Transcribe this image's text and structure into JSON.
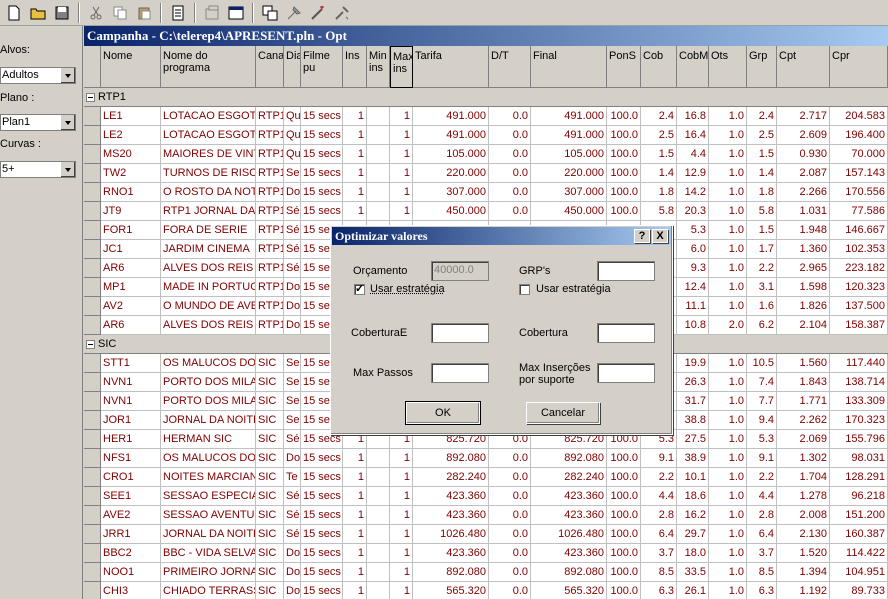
{
  "toolbar": {
    "icons": [
      "new-file-icon",
      "open-folder-icon",
      "save-icon",
      "cut-icon",
      "copy-icon",
      "paste-icon",
      "report-icon",
      "properties-icon",
      "window-icon",
      "grid-icon",
      "tools-icon",
      "wand-icon",
      "optimize-icon"
    ]
  },
  "left_panel": {
    "alvos_label": "Alvos:",
    "alvos_value": "Adultos",
    "plano_label": "Plano :",
    "plano_value": "Plan1",
    "curvas_label": "Curvas :",
    "curvas_value": "5+"
  },
  "window": {
    "title": "Campanha - C:\\telerep4\\APRESENT.pln - Opt"
  },
  "grid": {
    "columns": [
      "Nome",
      "Nome do programa",
      "Canal",
      "Dia",
      "Filme pu",
      "Ins",
      "Min ins",
      "Max ins",
      "Tarifa",
      "D/T",
      "Final",
      "PonS",
      "Cob",
      "CobM",
      "Ots",
      "Grp",
      "Cpt",
      "Cpr"
    ],
    "groups": [
      {
        "name": "RTP1",
        "rows": [
          [
            "LE1",
            "LOTACAO ESGOT",
            "RTP1",
            "Qu",
            "15 secs",
            "1",
            "",
            "1",
            "491.000",
            "0.0",
            "491.000",
            "100.0",
            "2.4",
            "16.8",
            "1.0",
            "2.4",
            "2.717",
            "204.583"
          ],
          [
            "LE2",
            "LOTACAO ESGOT",
            "RTP1",
            "Qu",
            "15 secs",
            "1",
            "",
            "1",
            "491.000",
            "0.0",
            "491.000",
            "100.0",
            "2.5",
            "16.4",
            "1.0",
            "2.5",
            "2.609",
            "196.400"
          ],
          [
            "MS20",
            "MAIORES DE VINTI",
            "RTP1",
            "Qu",
            "15 secs",
            "1",
            "",
            "1",
            "105.000",
            "0.0",
            "105.000",
            "100.0",
            "1.5",
            "4.4",
            "1.0",
            "1.5",
            "0.930",
            "70.000"
          ],
          [
            "TW2",
            "TURNOS DE RISCO",
            "RTP1",
            "Se",
            "15 secs",
            "1",
            "",
            "1",
            "220.000",
            "0.0",
            "220.000",
            "100.0",
            "1.4",
            "12.9",
            "1.0",
            "1.4",
            "2.087",
            "157.143"
          ],
          [
            "RNO1",
            "O ROSTO DA NOT",
            "RTP1",
            "Do",
            "15 secs",
            "1",
            "",
            "1",
            "307.000",
            "0.0",
            "307.000",
            "100.0",
            "1.8",
            "14.2",
            "1.0",
            "1.8",
            "2.266",
            "170.556"
          ],
          [
            "JT9",
            "RTP1 JORNAL DA",
            "RTP1",
            "Sé",
            "15 secs",
            "1",
            "",
            "1",
            "450.000",
            "0.0",
            "450.000",
            "100.0",
            "5.8",
            "20.3",
            "1.0",
            "5.8",
            "1.031",
            "77.586"
          ],
          [
            "FOR1",
            "FORA DE SERIE",
            "RTP1",
            "Sé",
            "15 se",
            "",
            "",
            "",
            "",
            "",
            "",
            "",
            "",
            "5.3",
            "1.0",
            "1.5",
            "1.948",
            "146.667"
          ],
          [
            "JC1",
            "JARDIM CINEMA",
            "RTP1",
            "Sé",
            "15 se",
            "",
            "",
            "",
            "",
            "",
            "",
            "",
            "",
            "6.0",
            "1.0",
            "1.7",
            "1.360",
            "102.353"
          ],
          [
            "AR6",
            "ALVES DOS REIS",
            "RTP1",
            "Sé",
            "15 se",
            "",
            "",
            "",
            "",
            "",
            "",
            "",
            "",
            "9.3",
            "1.0",
            "2.2",
            "2.965",
            "223.182"
          ],
          [
            "MP1",
            "MADE IN PORTUGA",
            "RTP1",
            "Do",
            "15 se",
            "",
            "",
            "",
            "",
            "",
            "",
            "",
            "",
            "12.4",
            "1.0",
            "3.1",
            "1.598",
            "120.323"
          ],
          [
            "AV2",
            "O MUNDO DE AVE",
            "RTP1",
            "Do",
            "15 se",
            "",
            "",
            "",
            "",
            "",
            "",
            "",
            "",
            "11.1",
            "1.0",
            "1.6",
            "1.826",
            "137.500"
          ],
          [
            "AR6",
            "ALVES DOS REIS",
            "RTP1",
            "Do",
            "15 se",
            "",
            "",
            "",
            "",
            "",
            "",
            "",
            "",
            "10.8",
            "2.0",
            "6.2",
            "2.104",
            "158.387"
          ]
        ]
      },
      {
        "name": "SIC",
        "rows": [
          [
            "STT1",
            "OS MALUCOS DO",
            "SIC",
            "Se",
            "15 se",
            "",
            "",
            "",
            "",
            "",
            "",
            "",
            "",
            "19.9",
            "1.0",
            "10.5",
            "1.560",
            "117.440"
          ],
          [
            "NVN1",
            "PORTO DOS MILA(",
            "SIC",
            "Se",
            "15 se",
            "",
            "",
            "",
            "",
            "",
            "",
            "",
            "",
            "26.3",
            "1.0",
            "7.4",
            "1.843",
            "138.714"
          ],
          [
            "NVN1",
            "PORTO DOS MILA(",
            "SIC",
            "Se",
            "15 se",
            "",
            "",
            "",
            "",
            "",
            "",
            "",
            "",
            "31.7",
            "1.0",
            "7.7",
            "1.771",
            "133.309"
          ],
          [
            "JOR1",
            "JORNAL DA NOITE",
            "SIC",
            "Se",
            "15 se",
            "",
            "",
            "",
            "",
            "",
            "",
            "",
            "",
            "38.8",
            "1.0",
            "9.4",
            "2.262",
            "170.323"
          ],
          [
            "HER1",
            "HERMAN SIC",
            "SIC",
            "Sé",
            "15 secs",
            "1",
            "",
            "1",
            "825.720",
            "0.0",
            "825.720",
            "100.0",
            "5.3",
            "27.5",
            "1.0",
            "5.3",
            "2.069",
            "155.796"
          ],
          [
            "NFS1",
            "OS MALUCOS DO",
            "SIC",
            "Do",
            "15 secs",
            "1",
            "",
            "1",
            "892.080",
            "0.0",
            "892.080",
            "100.0",
            "9.1",
            "38.9",
            "1.0",
            "9.1",
            "1.302",
            "98.031"
          ],
          [
            "CRO1",
            "NOITES MARCIANA",
            "SIC",
            "Te",
            "15 secs",
            "1",
            "",
            "1",
            "282.240",
            "0.0",
            "282.240",
            "100.0",
            "2.2",
            "10.1",
            "1.0",
            "2.2",
            "1.704",
            "128.291"
          ],
          [
            "SEE1",
            "SESSAO ESPECIAI",
            "SIC",
            "Sé",
            "15 secs",
            "1",
            "",
            "1",
            "423.360",
            "0.0",
            "423.360",
            "100.0",
            "4.4",
            "18.6",
            "1.0",
            "4.4",
            "1.278",
            "96.218"
          ],
          [
            "AVE2",
            "SESSAO AVENTUI",
            "SIC",
            "Sé",
            "15 secs",
            "1",
            "",
            "1",
            "423.360",
            "0.0",
            "423.360",
            "100.0",
            "2.8",
            "16.2",
            "1.0",
            "2.8",
            "2.008",
            "151.200"
          ],
          [
            "JRR1",
            "JORNAL DA NOITE",
            "SIC",
            "Sé",
            "15 secs",
            "1",
            "",
            "1",
            "1026.480",
            "0.0",
            "1026.480",
            "100.0",
            "6.4",
            "29.7",
            "1.0",
            "6.4",
            "2.130",
            "160.387"
          ],
          [
            "BBC2",
            "BBC - VIDA SELVA",
            "SIC",
            "Do",
            "15 secs",
            "1",
            "",
            "1",
            "423.360",
            "0.0",
            "423.360",
            "100.0",
            "3.7",
            "18.0",
            "1.0",
            "3.7",
            "1.520",
            "114.422"
          ],
          [
            "NOO1",
            "PRIMEIRO JORNAL",
            "SIC",
            "Do",
            "15 secs",
            "1",
            "",
            "1",
            "892.080",
            "0.0",
            "892.080",
            "100.0",
            "8.5",
            "33.5",
            "1.0",
            "8.5",
            "1.394",
            "104.951"
          ],
          [
            "CHI3",
            "CHIADO TERRASS",
            "SIC",
            "Do",
            "15 secs",
            "1",
            "",
            "1",
            "565.320",
            "0.0",
            "565.320",
            "100.0",
            "6.3",
            "26.1",
            "1.0",
            "6.3",
            "1.192",
            "89.733"
          ]
        ]
      }
    ]
  },
  "dialog": {
    "title": "Optimizar valores",
    "help_label": "?",
    "close_label": "X",
    "orcamento_label": "Orçamento",
    "orcamento_value": "40000.0",
    "grps_label": "GRP's",
    "grps_value": "",
    "usar1_label": "Usar estratégia",
    "usar2_label": "Usar estratégia",
    "coberturae_label": "CoberturaE",
    "coberturae_value": "",
    "cobertura_label": "Cobertura",
    "cobertura_value": "",
    "maxpassos_label": "Max Passos",
    "maxpassos_value": "",
    "maxins_label": "Max Inserções por suporte",
    "maxins_value": "",
    "ok_label": "OK",
    "cancel_label": "Cancelar"
  }
}
